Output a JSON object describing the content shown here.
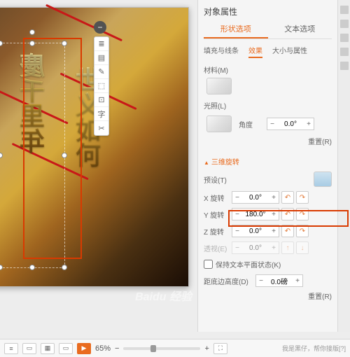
{
  "panel": {
    "title": "对象属性",
    "tabs": {
      "shape": "形状选项",
      "text": "文本选项"
    },
    "subtabs": {
      "fill": "填充与线条",
      "effects": "效果",
      "size": "大小与属性"
    },
    "material_label": "材料(M)",
    "light_label": "光照(L)",
    "angle_label": "角度",
    "angle_value": "0.0°",
    "reset": "重置(R)",
    "section_3d": "三维旋转",
    "preset_label": "预设(T)",
    "x_label": "X 旋转",
    "x_value": "0.0°",
    "y_label": "Y 旋转",
    "y_value": "180.0°",
    "z_label": "Z 旋转",
    "z_value": "0.0°",
    "perspective_label": "透视(E)",
    "perspective_value": "0.0°",
    "keep_flat_label": "保持文本平面状态(K)",
    "distance_label": "距底边高度(D)",
    "distance_value": "0.0磅"
  },
  "float_tools": [
    "≣",
    "▤",
    "✎",
    "⬚",
    "⊡",
    "字",
    "✂"
  ],
  "canvas_text": {
    "col1": "慶千里年",
    "col2": "世义如何"
  },
  "status": {
    "zoom": "65%",
    "footer_text": "我是黑仔，帮你接版[?]"
  },
  "watermark": "Baidu 经验"
}
